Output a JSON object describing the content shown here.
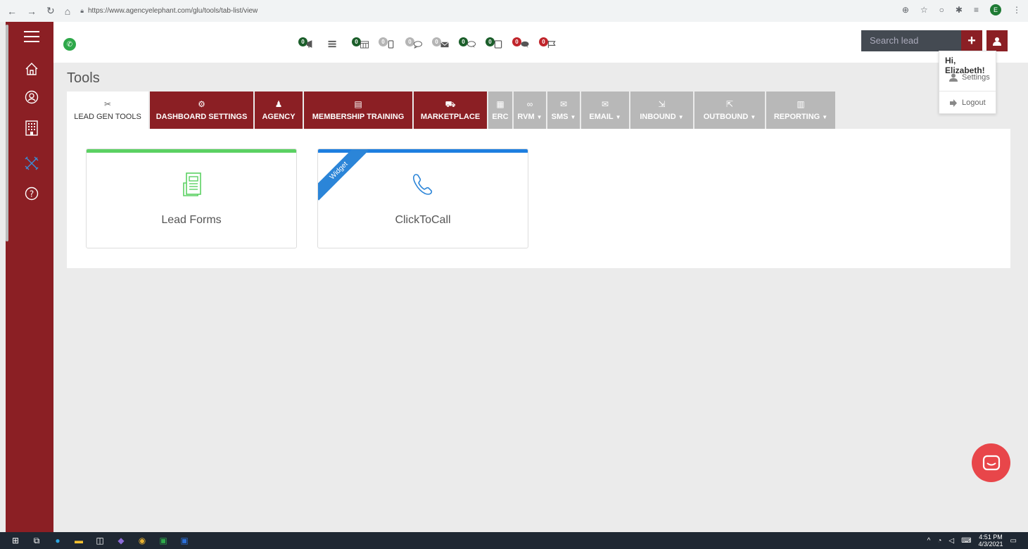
{
  "browser": {
    "url": "https://www.agencyelephant.com/glu/tools/tab-list/view",
    "profile_initial": "E"
  },
  "header": {
    "search_placeholder": "Search lead",
    "plus_label": "+",
    "notifications": [
      {
        "count": "0",
        "color": "#1b5e2a",
        "icon": "megaphone-icon"
      },
      {
        "count": "",
        "color": "",
        "icon": "list-icon"
      },
      {
        "count": "0",
        "color": "#1b5e2a",
        "icon": "calendar-icon"
      },
      {
        "count": "0",
        "color": "#b5b5b5",
        "icon": "mobile-icon"
      },
      {
        "count": "0",
        "color": "#b5b5b5",
        "icon": "chat-bubble-icon"
      },
      {
        "count": "0",
        "color": "#b5b5b5",
        "icon": "envelope-icon"
      },
      {
        "count": "0",
        "color": "#1b5e2a",
        "icon": "chat-reply-icon"
      },
      {
        "count": "0",
        "color": "#1b5e2a",
        "icon": "phone-box-icon"
      },
      {
        "count": "0",
        "color": "#c0252b",
        "icon": "chat-dots-icon"
      },
      {
        "count": "0",
        "color": "#c0252b",
        "icon": "flag-icon"
      }
    ]
  },
  "user_menu": {
    "greeting": "Hi, Elizabeth!",
    "settings_label": "Settings",
    "logout_label": "Logout"
  },
  "page": {
    "title": "Tools"
  },
  "tabs": [
    {
      "label": "LEAD GEN TOOLS",
      "state": "active",
      "icon": "tools-icon",
      "caret": false,
      "glyph": "✂"
    },
    {
      "label": "DASHBOARD SETTINGS",
      "state": "red",
      "icon": "gear-icon",
      "caret": false,
      "glyph": "⚙"
    },
    {
      "label": "AGENCY",
      "state": "red",
      "icon": "users-icon",
      "caret": false,
      "glyph": "♟"
    },
    {
      "label": "MEMBERSHIP TRAINING",
      "state": "red",
      "icon": "book-icon",
      "caret": false,
      "glyph": "▤"
    },
    {
      "label": "MARKETPLACE",
      "state": "red",
      "icon": "cart-icon",
      "caret": false,
      "glyph": "⛟"
    },
    {
      "label": "ERC",
      "state": "gray",
      "icon": "grid-icon",
      "caret": false,
      "glyph": "▦"
    },
    {
      "label": "RVM",
      "state": "gray",
      "icon": "voicemail-icon",
      "caret": true,
      "glyph": "∞"
    },
    {
      "label": "SMS",
      "state": "gray",
      "icon": "message-icon",
      "caret": true,
      "glyph": "✉"
    },
    {
      "label": "EMAIL",
      "state": "gray",
      "icon": "open-envelope-icon",
      "caret": true,
      "glyph": "✉"
    },
    {
      "label": "INBOUND",
      "state": "gray",
      "icon": "sign-in-icon",
      "caret": true,
      "glyph": "⇲"
    },
    {
      "label": "OUTBOUND",
      "state": "gray",
      "icon": "sign-out-icon",
      "caret": true,
      "glyph": "⇱"
    },
    {
      "label": "REPORTING",
      "state": "gray",
      "icon": "clipboard-icon",
      "caret": true,
      "glyph": "▥"
    }
  ],
  "cards": [
    {
      "label": "Lead Forms",
      "accent": "#5bd163",
      "icon": "form-icon",
      "ribbon": ""
    },
    {
      "label": "ClickToCall",
      "accent": "#1e7fe0",
      "icon": "phone-icon",
      "ribbon": "Widget"
    }
  ],
  "taskbar": {
    "time": "4:51 PM",
    "date": "4/3/2021"
  },
  "colors": {
    "brand": "#8b1f24",
    "inactive_tab": "#b8b8b8",
    "chat": "#e8464a"
  }
}
